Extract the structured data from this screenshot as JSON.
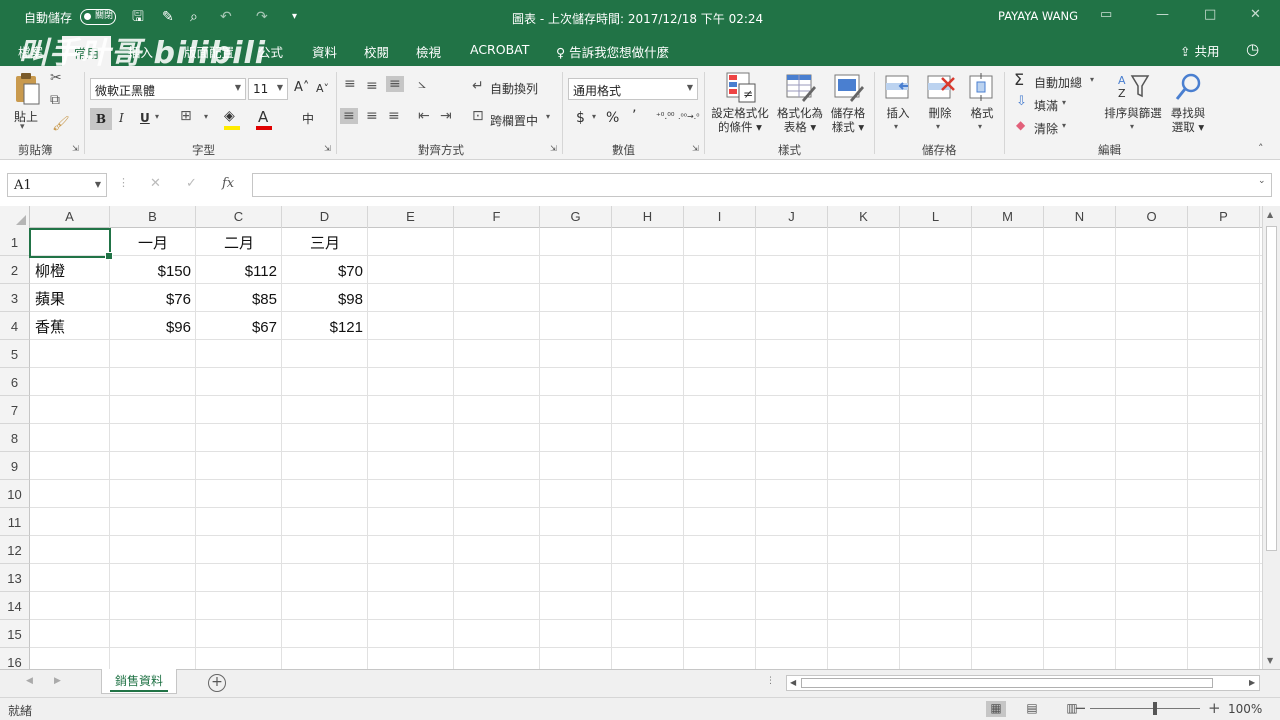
{
  "titlebar": {
    "autosave_label": "自動儲存",
    "autosave_state": "關閉",
    "document_title": "圖表 - 上次儲存時間: 2017/12/18 下午 02:24",
    "user_name": "PAYAYA WANG"
  },
  "watermark": "叫手叶哥 bilibili",
  "tabs": {
    "items": [
      "檔案",
      "常用",
      "插入",
      "版面配置",
      "公式",
      "資料",
      "校閱",
      "檢視",
      "ACROBAT"
    ],
    "active": "常用",
    "tell_me": "告訴我您想做什麼",
    "share": "共用"
  },
  "ribbon": {
    "clipboard": {
      "paste": "貼上",
      "label": "剪貼簿"
    },
    "font": {
      "name": "微軟正黑體",
      "size": "11",
      "bold": "B",
      "italic": "I",
      "underline": "U",
      "label": "字型"
    },
    "alignment": {
      "wrap_text": "自動換列",
      "merge_center": "跨欄置中",
      "label": "對齊方式"
    },
    "number": {
      "format": "通用格式",
      "currency": "$",
      "percent": "%",
      "comma": "’",
      "inc_decimal": "⁺⁰.⁰⁰",
      "dec_decimal": ".⁰⁰→.⁰",
      "label": "數值"
    },
    "styles": {
      "cond_format": [
        "設定格式化",
        "的條件"
      ],
      "format_table": [
        "格式化為",
        "表格"
      ],
      "cell_styles": [
        "儲存格",
        "樣式"
      ],
      "label": "樣式"
    },
    "cells": {
      "insert": "插入",
      "delete": "刪除",
      "format": "格式",
      "label": "儲存格"
    },
    "editing": {
      "autosum": "自動加總",
      "fill": "填滿",
      "clear": "清除",
      "sort_filter": "排序與篩選",
      "find_select": [
        "尋找與",
        "選取"
      ],
      "label": "編輯"
    }
  },
  "formula_bar": {
    "name_box": "A1",
    "formula": ""
  },
  "columns": [
    "A",
    "B",
    "C",
    "D",
    "E",
    "F",
    "G",
    "H",
    "I",
    "J",
    "K",
    "L",
    "M",
    "N",
    "O",
    "P"
  ],
  "rows": [
    "1",
    "2",
    "3",
    "4",
    "5",
    "6",
    "7",
    "8",
    "9",
    "10",
    "11",
    "12",
    "13",
    "14",
    "15",
    "16"
  ],
  "cells": {
    "B1": "一月",
    "C1": "二月",
    "D1": "三月",
    "A2": "柳橙",
    "B2": "$150",
    "C2": "$112",
    "D2": "$70",
    "A3": "蘋果",
    "B3": "$76",
    "C3": "$85",
    "D3": "$98",
    "A4": "香蕉",
    "B4": "$96",
    "C4": "$67",
    "D4": "$121"
  },
  "sheets": {
    "active": "銷售資料"
  },
  "statusbar": {
    "status": "就緒",
    "zoom": "100%"
  },
  "colors": {
    "accent": "#217346"
  }
}
